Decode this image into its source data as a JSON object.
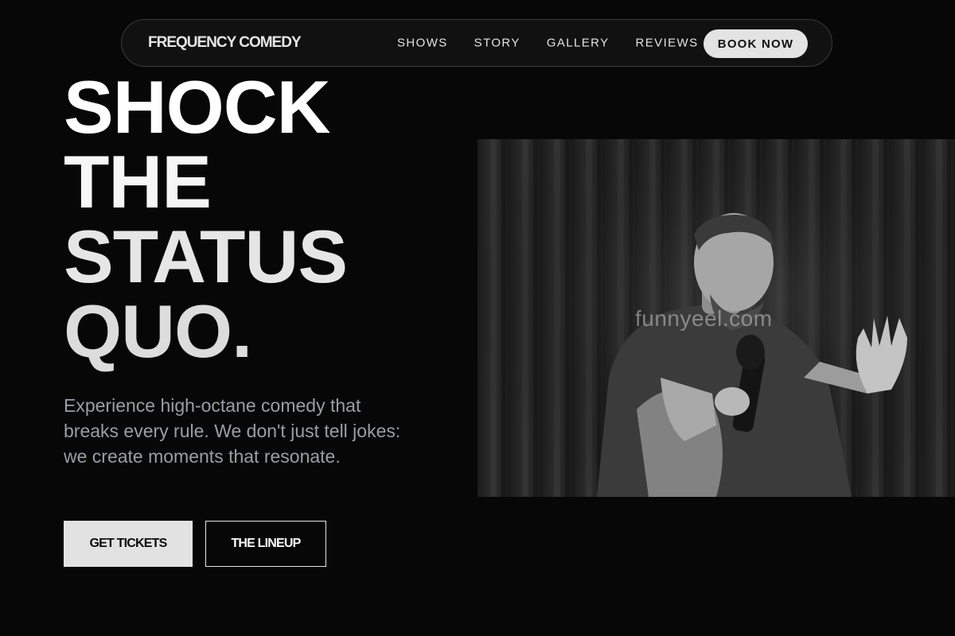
{
  "nav": {
    "brand": "FREQUENCY COMEDY",
    "links": [
      "SHOWS",
      "STORY",
      "GALLERY",
      "REVIEWS"
    ],
    "cta": "BOOK NOW"
  },
  "hero": {
    "headline_lines": [
      "SHOCK",
      "THE",
      "STATUS",
      "QUO."
    ],
    "subtext": "Experience high-octane comedy that breaks every rule. We don't just tell jokes: we create moments that resonate.",
    "primary_cta": "GET TICKETS",
    "secondary_cta": "THE LINEUP"
  },
  "photo": {
    "watermark": "funnyeel.com"
  },
  "colors": {
    "background": "#070707",
    "nav_bg": "#111111",
    "button_light": "#e2e2e2",
    "subtext": "#9a9ea4"
  }
}
